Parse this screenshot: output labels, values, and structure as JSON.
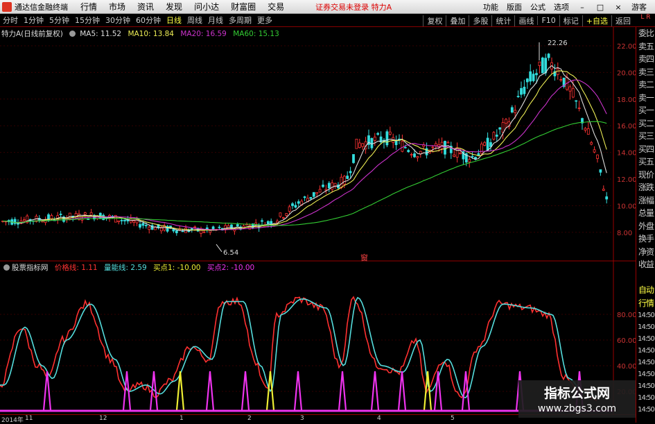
{
  "menubar": {
    "app_name": "通达信金融终端",
    "items": [
      "行情",
      "市场",
      "资讯",
      "发现",
      "问小达",
      "财富圈",
      "交易"
    ],
    "notice": "证券交易未登录 特力A",
    "right_items": [
      "功能",
      "版面",
      "公式",
      "选项"
    ],
    "guest": "游客"
  },
  "periods": {
    "items": [
      "分时",
      "1分钟",
      "5分钟",
      "15分钟",
      "30分钟",
      "60分钟",
      "日线",
      "周线",
      "月线",
      "多周期",
      "更多"
    ],
    "active": "日线"
  },
  "tools": [
    "复权",
    "叠加",
    "多股",
    "统计",
    "画线",
    "F10",
    "标记",
    "+自选",
    "返回"
  ],
  "side_top": "L R",
  "main_legend": {
    "title": "特力A(日线前复权)",
    "ma5": "MA5: 11.52",
    "ma10": "MA10: 13.84",
    "ma20": "MA20: 16.59",
    "ma60": "MA60: 15.13"
  },
  "indicator_legend": {
    "name": "股票指标网",
    "v1": "价格线: 1.11",
    "v2": "量能线: 2.59",
    "v3": "买点1: -10.00",
    "v4": "买点2: -10.00"
  },
  "colors": {
    "up": "#ff3333",
    "down": "#33dddd",
    "ma5": "#dddddd",
    "ma10": "#eeee55",
    "ma20": "#cc33cc",
    "ma60": "#33cc33",
    "price_line": "#ff3030",
    "volume_line": "#55dddd",
    "buy1": "#eeee33",
    "buy2": "#ee33ee"
  },
  "price_axis": [
    "22.00",
    "20.00",
    "18.00",
    "16.00",
    "14.00",
    "12.00",
    "10.00",
    "8.00"
  ],
  "indicator_axis": [
    "80.00",
    "60.00",
    "40.00",
    "20.00"
  ],
  "annotations": {
    "high_label": "22.26",
    "low_label": "6.54",
    "marker": "窗"
  },
  "side_panel": [
    "委比",
    "卖五",
    "卖四",
    "卖三",
    "卖二",
    "卖一",
    "买一",
    "买二",
    "买三",
    "买四",
    "买五",
    "现价",
    "涨跌",
    "涨幅",
    "总量",
    "外盘",
    "换手",
    "净资",
    "收益",
    "",
    "自动",
    "行情",
    "14:50",
    "14:50",
    "14:50",
    "14:50",
    "14:50",
    "14:50",
    "14:50",
    "14:50",
    "14:50"
  ],
  "date_labels": [
    "2014年",
    "11",
    "12",
    "1",
    "2",
    "3",
    "4",
    "5"
  ],
  "watermark": {
    "line1": "指标公式网",
    "line2": "www.zbgs3.com"
  }
}
